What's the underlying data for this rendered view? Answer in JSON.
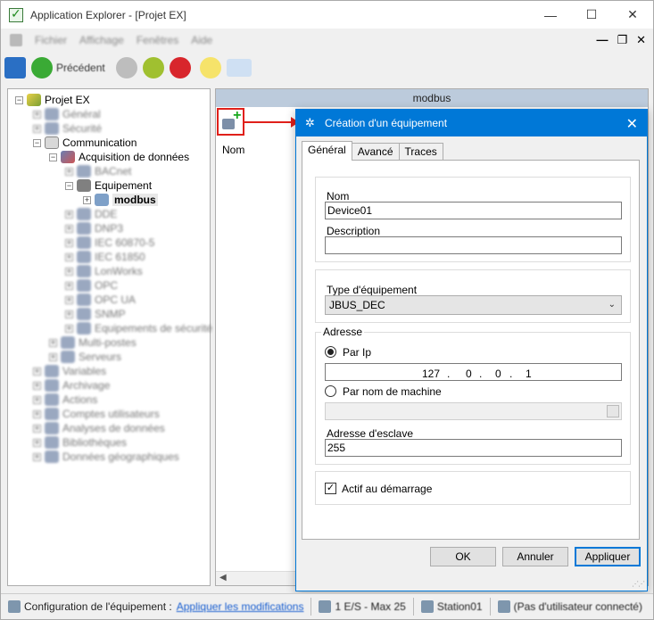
{
  "window": {
    "title": "Application Explorer - [Projet EX]"
  },
  "menu": {
    "items": [
      "Fichier",
      "Affichage",
      "Fenêtres",
      "Aide"
    ]
  },
  "toolbar": {
    "back_label": "Précédent"
  },
  "tree": {
    "root": "Projet EX",
    "items": [
      {
        "label": "Général",
        "blurred": true
      },
      {
        "label": "Sécurité",
        "blurred": true
      },
      {
        "label": "Communication",
        "blurred": false
      },
      {
        "label": "Acquisition de données",
        "blurred": false
      },
      {
        "label": "BACnet",
        "blurred": true
      },
      {
        "label": "Equipement",
        "blurred": false
      },
      {
        "label": "modbus",
        "blurred": false
      },
      {
        "label": "DDE",
        "blurred": true
      },
      {
        "label": "DNP3",
        "blurred": true
      },
      {
        "label": "IEC 60870-5",
        "blurred": true
      },
      {
        "label": "IEC 61850",
        "blurred": true
      },
      {
        "label": "LonWorks",
        "blurred": true
      },
      {
        "label": "OPC",
        "blurred": true
      },
      {
        "label": "OPC UA",
        "blurred": true
      },
      {
        "label": "SNMP",
        "blurred": true
      },
      {
        "label": "Equipements de sécurité",
        "blurred": true
      },
      {
        "label": "Multi-postes",
        "blurred": true
      },
      {
        "label": "Serveurs",
        "blurred": true
      },
      {
        "label": "Variables",
        "blurred": true
      },
      {
        "label": "Archivage",
        "blurred": true
      },
      {
        "label": "Actions",
        "blurred": true
      },
      {
        "label": "Comptes utilisateurs",
        "blurred": true
      },
      {
        "label": "Analyses de données",
        "blurred": true
      },
      {
        "label": "Bibliothèques",
        "blurred": true
      },
      {
        "label": "Données géographiques",
        "blurred": true
      }
    ]
  },
  "right_panel": {
    "header": "modbus",
    "column_name": "Nom"
  },
  "dialog": {
    "title": "Création d'un équipement",
    "tabs": [
      "Général",
      "Avancé",
      "Traces"
    ],
    "name_label": "Nom",
    "name_value": "Device01",
    "description_label": "Description",
    "description_value": "",
    "type_label": "Type d'équipement",
    "type_value": "JBUS_DEC",
    "address_legend": "Adresse",
    "by_ip_label": "Par Ip",
    "ip": {
      "a": "127",
      "b": "0",
      "c": "0",
      "d": "1"
    },
    "by_machine_label": "Par nom de machine",
    "machine_value": "",
    "slave_label": "Adresse d'esclave",
    "slave_value": "255",
    "active_label": "Actif au démarrage",
    "active_checked": true,
    "buttons": {
      "ok": "OK",
      "cancel": "Annuler",
      "apply": "Appliquer"
    }
  },
  "statusbar": {
    "config_label": "Configuration de l'équipement :",
    "apply_link": "Appliquer les modifications",
    "es_info": "1 E/S - Max 25",
    "station": "Station01",
    "user": "(Pas d'utilisateur connecté)"
  },
  "colors": {
    "accent": "#0078d7",
    "highlight": "#e0201a"
  }
}
